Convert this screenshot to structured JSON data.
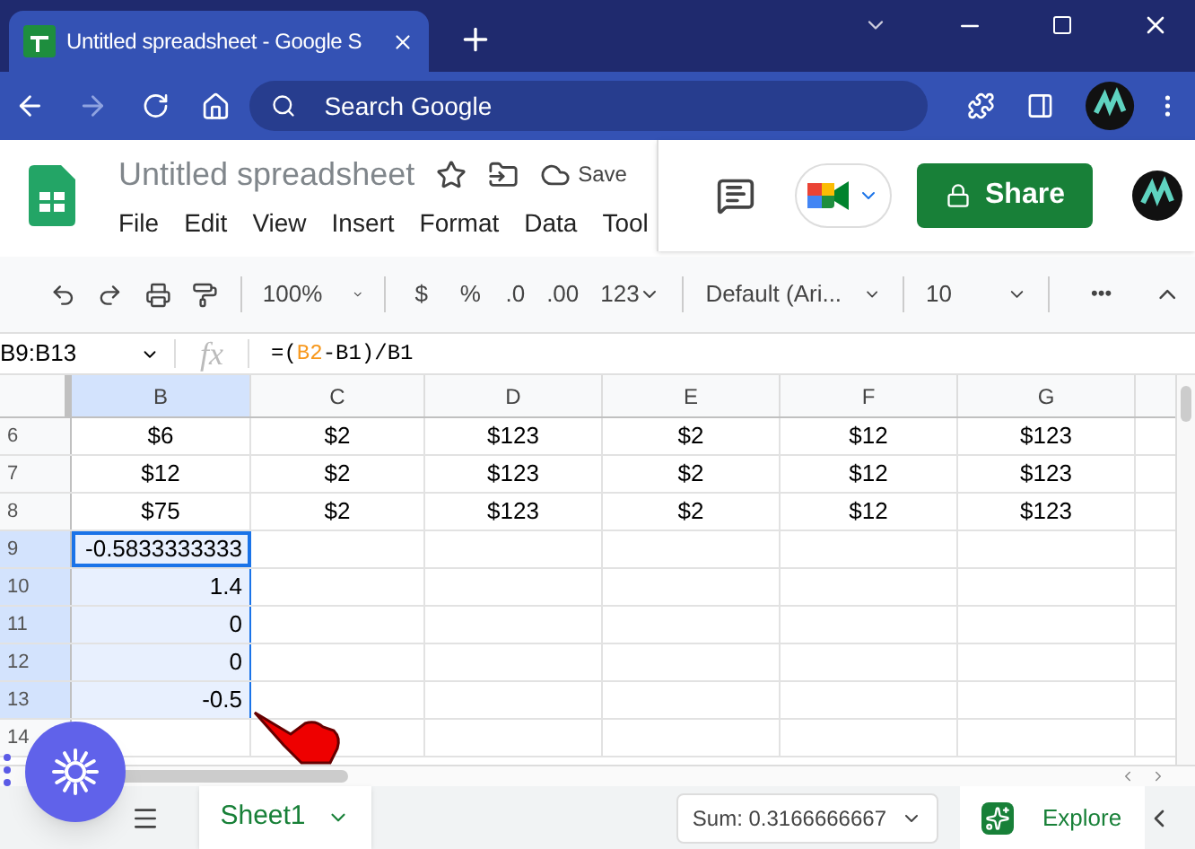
{
  "browser": {
    "tab_title": "Untitled spreadsheet - Google S",
    "address_placeholder": "Search Google"
  },
  "doc": {
    "title": "Untitled spreadsheet",
    "save_status": "Save",
    "menus": [
      "File",
      "Edit",
      "View",
      "Insert",
      "Format",
      "Data",
      "Tool"
    ],
    "share": "Share"
  },
  "toolbar": {
    "zoom": "100%",
    "currency": "$",
    "percent": "%",
    "decrease_decimals": ".0",
    "increase_decimals": ".00",
    "number_format": "123",
    "font": "Default (Ari...",
    "font_size": "10",
    "more": "•••"
  },
  "formula_bar": {
    "name_box": "B9:B13",
    "fx": "fx",
    "formula_start": "=(",
    "formula_ref": "B2",
    "formula_rest": "-B1)/B1"
  },
  "columns": [
    "B",
    "C",
    "D",
    "E",
    "F",
    "G"
  ],
  "rows": [
    {
      "number": "6",
      "cells": [
        "$6",
        "$2",
        "$123",
        "$2",
        "$12",
        "$123"
      ],
      "selected": false,
      "active": false
    },
    {
      "number": "7",
      "cells": [
        "$12",
        "$2",
        "$123",
        "$2",
        "$12",
        "$123"
      ],
      "selected": false,
      "active": false
    },
    {
      "number": "8",
      "cells": [
        "$75",
        "$2",
        "$123",
        "$2",
        "$12",
        "$123"
      ],
      "selected": false,
      "active": false
    },
    {
      "number": "9",
      "cells": [
        "-0.5833333333",
        "",
        "",
        "",
        "",
        ""
      ],
      "selected": true,
      "active": true
    },
    {
      "number": "10",
      "cells": [
        "1.4",
        "",
        "",
        "",
        "",
        ""
      ],
      "selected": true,
      "active": false
    },
    {
      "number": "11",
      "cells": [
        "0",
        "",
        "",
        "",
        "",
        ""
      ],
      "selected": true,
      "active": false
    },
    {
      "number": "12",
      "cells": [
        "0",
        "",
        "",
        "",
        "",
        ""
      ],
      "selected": true,
      "active": false
    },
    {
      "number": "13",
      "cells": [
        "-0.5",
        "",
        "",
        "",
        "",
        ""
      ],
      "selected": true,
      "active": false
    },
    {
      "number": "14",
      "cells": [
        "",
        "",
        "",
        "",
        "",
        ""
      ],
      "selected": false,
      "active": false
    }
  ],
  "sheets": [
    {
      "name": "Sheet1",
      "selected": true
    }
  ],
  "status": {
    "sum": "Sum: 0.3166666667",
    "explore": "Explore"
  }
}
